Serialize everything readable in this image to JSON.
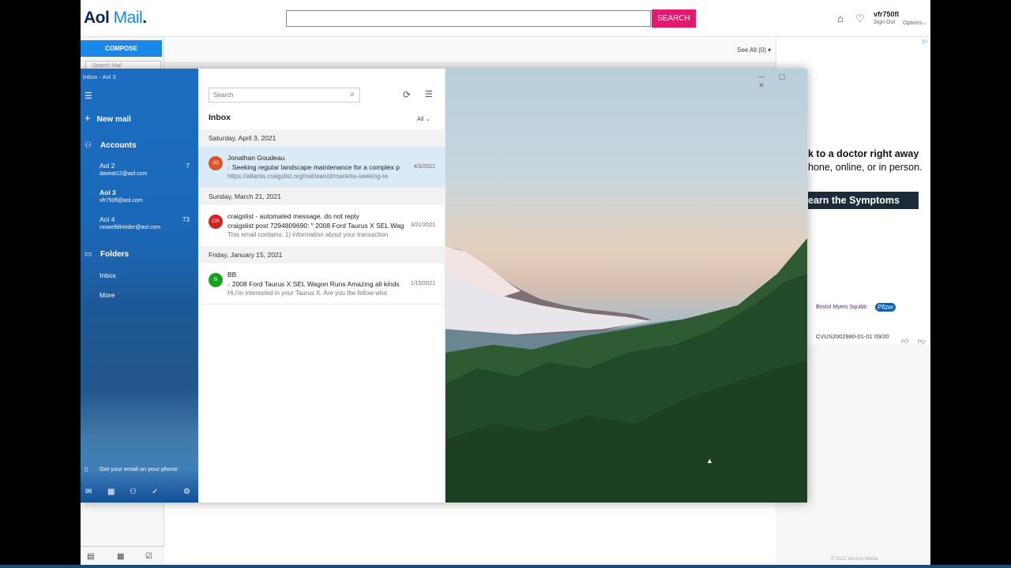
{
  "aol": {
    "logo_main": "Aol",
    "logo_mail": "Mail",
    "logo_dot": ".",
    "search_button": "SEARCH",
    "user": "vfr750fl",
    "sign_out": "Sign Out",
    "options": "Options",
    "compose": "COMPOSE",
    "search_mail_placeholder": "Search Mail",
    "see_all": "See All (0)",
    "copyright": "© 2021 Verizon Media"
  },
  "ad": {
    "line1": "k to a doctor right away",
    "line2": "hone, online, or in person.",
    "button": "earn the Symptoms",
    "sponsor1": "Bristol Myers Squibb",
    "sponsor2": "Pfizer",
    "code": "CVUS2002980-01-01 09/20"
  },
  "mailapp": {
    "window_title": "Inbox - Aol 3",
    "new_mail": "New mail",
    "accounts_label": "Accounts",
    "accounts": [
      {
        "name": "Aol 2",
        "email": "daveat12@aol.com",
        "count": "7"
      },
      {
        "name": "Aol 3",
        "email": "vfr750fl@aol.com",
        "count": ""
      },
      {
        "name": "Aol 4",
        "email": "roswelldirtrider@aol.com",
        "count": "73"
      }
    ],
    "folders_label": "Folders",
    "folders": [
      "Inbox",
      "More"
    ],
    "phone_promo": "Get your email on your phone",
    "search_placeholder": "Search",
    "inbox_title": "Inbox",
    "filter": "All",
    "groups": [
      {
        "date": "Saturday, April 3, 2021",
        "messages": [
          {
            "initials": "JG",
            "color": "#d9552b",
            "from": "Jonathan Goudeau",
            "subject": "Seeking regular landscape maintenance for a complex p",
            "preview": "https://atlanta.craigslist.org/nat/wan/d/marietta-seeking-re",
            "date": "4/3/2021"
          }
        ]
      },
      {
        "date": "Sunday, March 21, 2021",
        "messages": [
          {
            "initials": "CR",
            "color": "#d42121",
            "from": "craigslist - automated message, do not reply",
            "subject": "craigslist post 7294809690: \" 2008 Ford Taurus X SEL Wag",
            "preview": "This email contains: 1) information about your transaction",
            "date": "3/21/2021"
          }
        ]
      },
      {
        "date": "Friday, January 15, 2021",
        "messages": [
          {
            "initials": "B",
            "color": "#17a11c",
            "from": "BB",
            "subject": "2008 Ford Taurus X SEL Wagon Runs Amazing all kinds",
            "preview": "Hi,I'm interested in your Taurus X. Are you the fellow who",
            "date": "1/15/2021"
          }
        ]
      }
    ]
  }
}
